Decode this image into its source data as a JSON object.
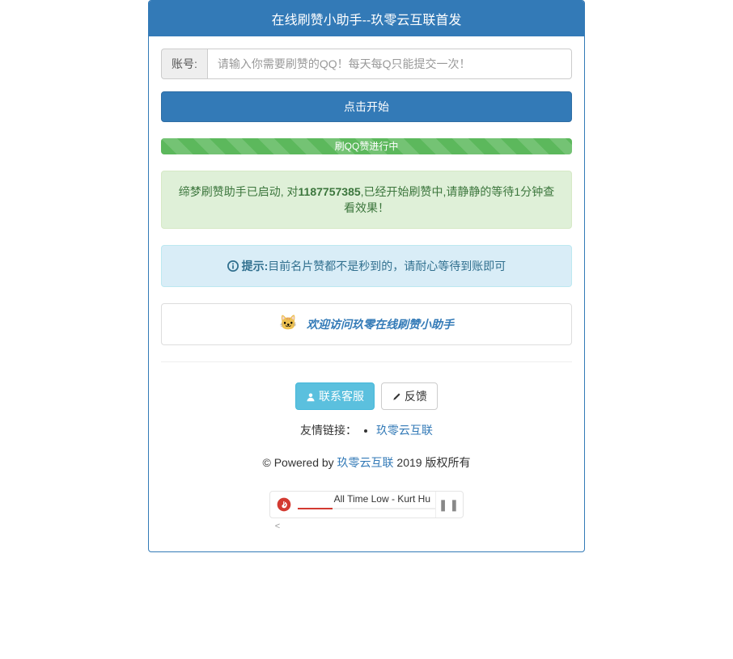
{
  "panel": {
    "title": "在线刷赞小助手--玖零云互联首发"
  },
  "form": {
    "account_label": "账号:",
    "placeholder": "请输入你需要刷赞的QQ！每天每Q只能提交一次！",
    "submit_label": "点击开始"
  },
  "progress": {
    "text": "刷QQ赞进行中"
  },
  "status": {
    "prefix": "缔梦刷赞助手已启动, 对",
    "qq": "1187757385",
    "suffix": ",已经开始刷赞中,请静静的等待1分钟查看效果！"
  },
  "tip": {
    "label": "提示:",
    "text": "目前名片赞都不是秒到的，请耐心等待到账即可"
  },
  "welcome": {
    "text": "欢迎访问玖零在线刷赞小助手"
  },
  "footer": {
    "contact_label": "联系客服",
    "feedback_label": "反馈",
    "friendly_title": "友情链接：",
    "friendly_link": "玖零云互联",
    "copyright_prefix": "© Powered by ",
    "copyright_link": "玖零云互联",
    "copyright_suffix": " 2019 版权所有"
  },
  "music": {
    "title": "All Time Low - Kurt Hu",
    "lt": "<"
  }
}
